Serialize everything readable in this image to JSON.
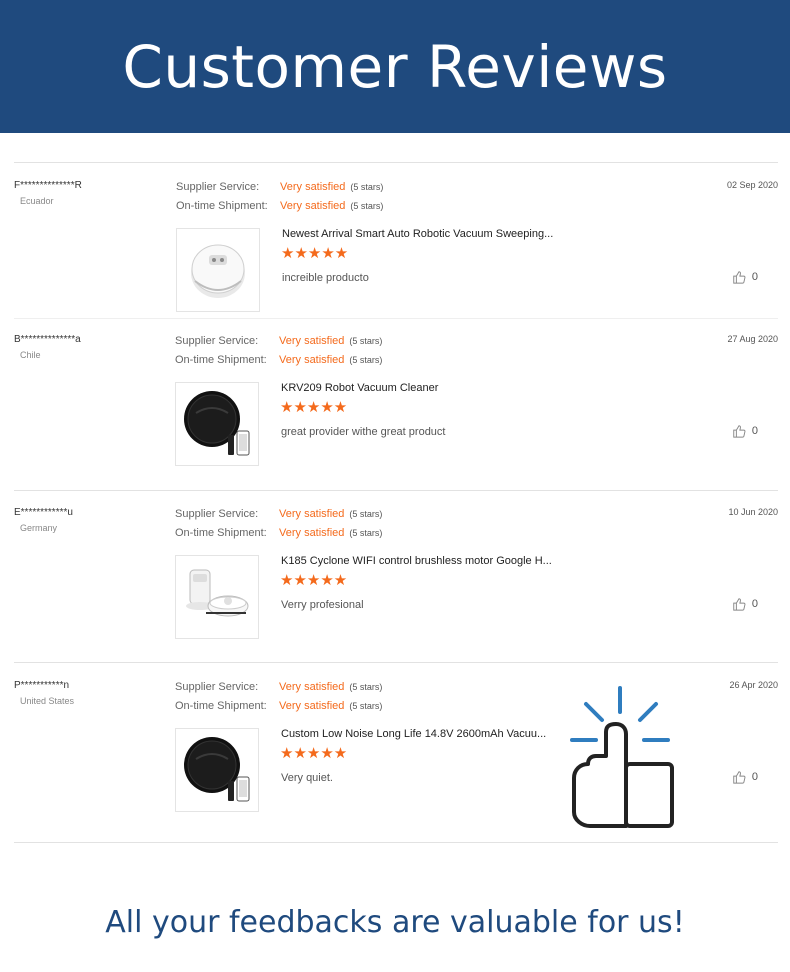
{
  "header": {
    "title": "Customer Reviews"
  },
  "labels": {
    "supplier_service": "Supplier Service:",
    "ontime_shipment": "On-time Shipment:"
  },
  "reviews": [
    {
      "user": "F**************R",
      "country": "Ecuador",
      "supplier_rating": "Very satisfied",
      "supplier_stars": "(5 stars)",
      "shipment_rating": "Very satisfied",
      "shipment_stars": "(5 stars)",
      "date": "02 Sep 2020",
      "product_title": "Newest Arrival Smart Auto Robotic Vacuum Sweeping...",
      "stars": "★★★★★",
      "comment": "increible producto",
      "likes": "0",
      "product_image_icon": "white-robot-vacuum"
    },
    {
      "user": "B**************a",
      "country": "Chile",
      "supplier_rating": "Very satisfied",
      "supplier_stars": "(5 stars)",
      "shipment_rating": "Very satisfied",
      "shipment_stars": "(5 stars)",
      "date": "27 Aug 2020",
      "product_title": "KRV209 Robot Vacuum Cleaner",
      "stars": "★★★★★",
      "comment": "great provider withe great product",
      "likes": "0",
      "product_image_icon": "black-robot-vacuum"
    },
    {
      "user": "E************u",
      "country": "Germany",
      "supplier_rating": "Very satisfied",
      "supplier_stars": "(5 stars)",
      "shipment_rating": "Very satisfied",
      "shipment_stars": "(5 stars)",
      "date": "10 Jun 2020",
      "product_title": "K185 Cyclone WIFI control brushless motor Google H...",
      "stars": "★★★★★",
      "comment": "Verry profesional",
      "likes": "0",
      "product_image_icon": "robot-vacuum-with-dock"
    },
    {
      "user": "P***********n",
      "country": "United States",
      "supplier_rating": "Very satisfied",
      "supplier_stars": "(5 stars)",
      "shipment_rating": "Very satisfied",
      "shipment_stars": "(5 stars)",
      "date": "26 Apr 2020",
      "product_title": "Custom Low Noise Long Life 14.8V 2600mAh Vacuu...",
      "stars": "★★★★★",
      "comment": "Very quiet.",
      "likes": "0",
      "product_image_icon": "black-robot-vacuum"
    }
  ],
  "decor": {
    "big_icon": "thumbs-up-icon"
  },
  "colors": {
    "brand": "#1f4a7e",
    "accent": "#f46a1c"
  },
  "footer": {
    "text": "All your feedbacks are valuable for us!"
  }
}
